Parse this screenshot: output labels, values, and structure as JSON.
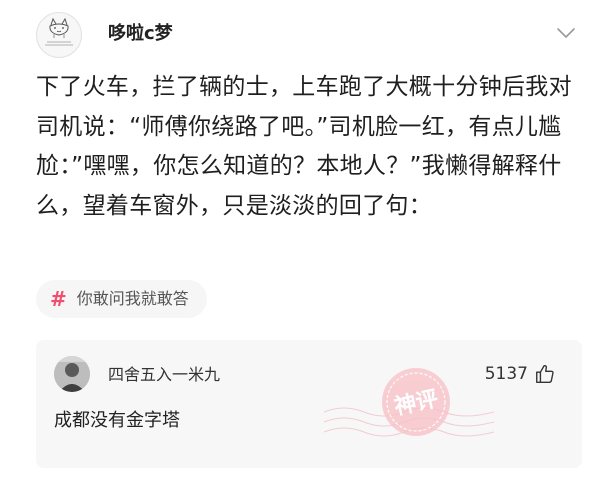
{
  "post": {
    "author": {
      "name": "哆啦c梦",
      "avatar_icon": "cat-doodle-avatar-icon"
    },
    "menu_icon": "chevron-down-icon",
    "text": "下了火车，拦了辆的士，上车跑了大概十分钟后我对司机说：“师傅你绕路了吧。”司机脸一红，有点儿尴尬：”嘿嘿，你怎么知道的？本地人？”我懒得解释什么，望着车窗外，只是淡淡的回了句：",
    "topic": {
      "icon": "hash-icon",
      "label": "你敢问我就敢答"
    }
  },
  "top_comment": {
    "user_name": "四舍五入一米九",
    "avatar_icon": "person-photo-avatar-icon",
    "likes": "5137",
    "like_icon": "thumbs-up-icon",
    "text": "成都没有金字塔",
    "stamp_text": "神评",
    "stamp_color": "#f4a3ae"
  },
  "colors": {
    "topic_hash": "#f0506e",
    "card_background": "#f7f7f7"
  }
}
